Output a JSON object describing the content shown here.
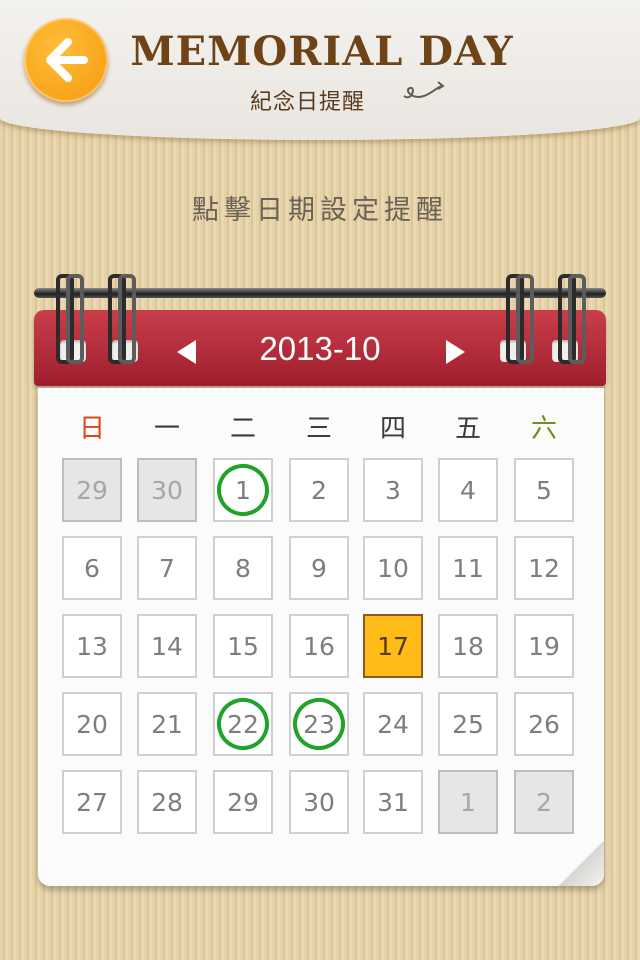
{
  "header": {
    "title": "MEMORIAL DAY",
    "subtitle": "紀念日提醒"
  },
  "hint": "點擊日期設定提醒",
  "calendar": {
    "month_label": "2013-10",
    "weekdays": [
      "日",
      "一",
      "二",
      "三",
      "四",
      "五",
      "六"
    ],
    "weekday_colors": [
      "#d9481b",
      "#3b3b3b",
      "#3b3b3b",
      "#3b3b3b",
      "#3b3b3b",
      "#3b3b3b",
      "#6e8f1e"
    ],
    "days": [
      {
        "label": "29",
        "state": "other"
      },
      {
        "label": "30",
        "state": "other"
      },
      {
        "label": "1",
        "state": "marked"
      },
      {
        "label": "2",
        "state": "normal"
      },
      {
        "label": "3",
        "state": "normal"
      },
      {
        "label": "4",
        "state": "normal"
      },
      {
        "label": "5",
        "state": "normal"
      },
      {
        "label": "6",
        "state": "normal"
      },
      {
        "label": "7",
        "state": "normal"
      },
      {
        "label": "8",
        "state": "normal"
      },
      {
        "label": "9",
        "state": "normal"
      },
      {
        "label": "10",
        "state": "normal"
      },
      {
        "label": "11",
        "state": "normal"
      },
      {
        "label": "12",
        "state": "normal"
      },
      {
        "label": "13",
        "state": "normal"
      },
      {
        "label": "14",
        "state": "normal"
      },
      {
        "label": "15",
        "state": "normal"
      },
      {
        "label": "16",
        "state": "normal"
      },
      {
        "label": "17",
        "state": "today"
      },
      {
        "label": "18",
        "state": "normal"
      },
      {
        "label": "19",
        "state": "normal"
      },
      {
        "label": "20",
        "state": "normal"
      },
      {
        "label": "21",
        "state": "normal"
      },
      {
        "label": "22",
        "state": "marked"
      },
      {
        "label": "23",
        "state": "marked"
      },
      {
        "label": "24",
        "state": "normal"
      },
      {
        "label": "25",
        "state": "normal"
      },
      {
        "label": "26",
        "state": "normal"
      },
      {
        "label": "27",
        "state": "normal"
      },
      {
        "label": "28",
        "state": "normal"
      },
      {
        "label": "29",
        "state": "normal"
      },
      {
        "label": "30",
        "state": "normal"
      },
      {
        "label": "31",
        "state": "normal"
      },
      {
        "label": "1",
        "state": "other"
      },
      {
        "label": "2",
        "state": "other"
      }
    ]
  },
  "colors": {
    "accent_orange": "#f39a0f",
    "calendar_red": "#b12a38",
    "marker_green": "#21a32a",
    "today_yellow": "#ffbb18"
  },
  "icons": {
    "back": "arrow-left-icon",
    "prev": "triangle-left-icon",
    "next": "triangle-right-icon"
  }
}
